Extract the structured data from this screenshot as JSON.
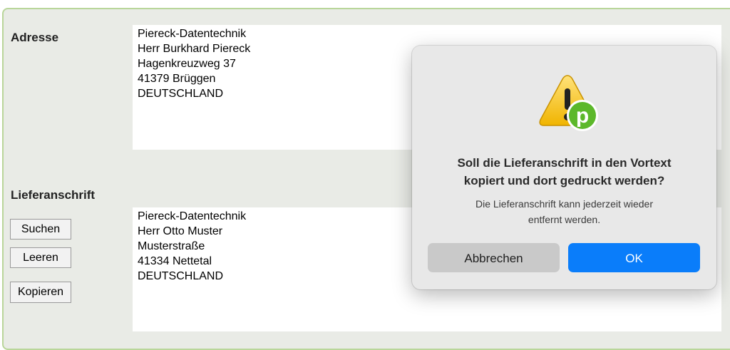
{
  "form": {
    "address_label": "Adresse",
    "address_lines": [
      "Piereck-Datentechnik",
      "Herr Burkhard Piereck",
      "Hagenkreuzweg 37",
      "41379 Brüggen",
      "DEUTSCHLAND"
    ],
    "delivery_label": "Lieferanschrift",
    "delivery_lines": [
      "Piereck-Datentechnik",
      "Herr Otto Muster",
      "Musterstraße",
      "41334 Nettetal",
      "DEUTSCHLAND"
    ],
    "search_button": "Suchen",
    "clear_button": "Leeren",
    "copy_button": "Kopieren"
  },
  "dialog": {
    "icon": "warning-app-icon",
    "badge_letter": "p",
    "title_line1": "Soll die Lieferanschrift in den Vortext",
    "title_line2": "kopiert und dort gedruckt werden?",
    "message_line1": "Die Lieferanschrift kann jederzeit wieder",
    "message_line2": "entfernt werden.",
    "cancel_label": "Abbrechen",
    "ok_label": "OK"
  },
  "colors": {
    "panel_bg": "#e9ebe6",
    "panel_border": "#b9d69a",
    "accent_blue": "#0a7dfa",
    "badge_green": "#5cb82a"
  }
}
